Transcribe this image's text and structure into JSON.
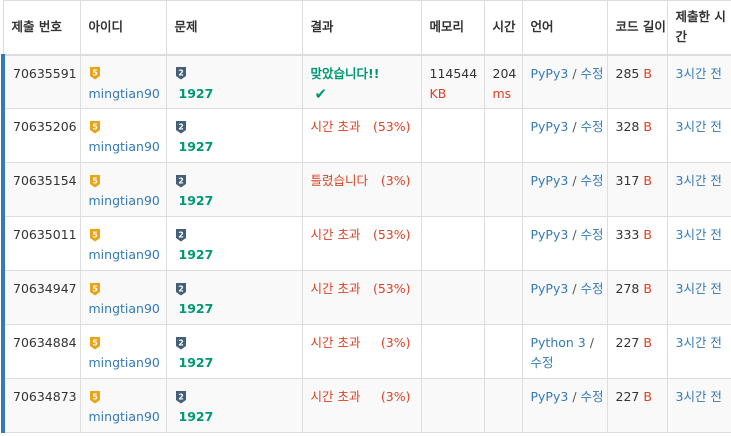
{
  "headers": {
    "submission_id": "제출 번호",
    "user": "아이디",
    "problem": "문제",
    "result": "결과",
    "memory": "메모리",
    "time": "시간",
    "language": "언어",
    "code_length": "코드 길이",
    "submitted": "제출한 시간"
  },
  "colors": {
    "accent": "#337ab7",
    "accepted": "#009874",
    "error": "#dd4124",
    "tier_gold": "#e8a317",
    "problem_badge": "#435f7a"
  },
  "rows": [
    {
      "id": "70635591",
      "user_tier": "5",
      "user": "mingtian90",
      "problem_tier": "2",
      "problem": "1927",
      "result": "맞았습니다!!",
      "result_type": "accepted",
      "result_pct": "",
      "memory": "114544",
      "memory_unit": "KB",
      "time": "204",
      "time_unit": "ms",
      "language": "PyPy3",
      "edit": "수정",
      "length": "285",
      "length_unit": "B",
      "submitted": "3시간 전"
    },
    {
      "id": "70635206",
      "user_tier": "5",
      "user": "mingtian90",
      "problem_tier": "2",
      "problem": "1927",
      "result": "시간 초과",
      "result_type": "tle",
      "result_pct": "(53%)",
      "memory": "",
      "memory_unit": "",
      "time": "",
      "time_unit": "",
      "language": "PyPy3",
      "edit": "수정",
      "length": "328",
      "length_unit": "B",
      "submitted": "3시간 전"
    },
    {
      "id": "70635154",
      "user_tier": "5",
      "user": "mingtian90",
      "problem_tier": "2",
      "problem": "1927",
      "result": "틀렸습니다",
      "result_type": "wrong",
      "result_pct": "(3%)",
      "memory": "",
      "memory_unit": "",
      "time": "",
      "time_unit": "",
      "language": "PyPy3",
      "edit": "수정",
      "length": "317",
      "length_unit": "B",
      "submitted": "3시간 전"
    },
    {
      "id": "70635011",
      "user_tier": "5",
      "user": "mingtian90",
      "problem_tier": "2",
      "problem": "1927",
      "result": "시간 초과",
      "result_type": "tle",
      "result_pct": "(53%)",
      "memory": "",
      "memory_unit": "",
      "time": "",
      "time_unit": "",
      "language": "PyPy3",
      "edit": "수정",
      "length": "333",
      "length_unit": "B",
      "submitted": "3시간 전"
    },
    {
      "id": "70634947",
      "user_tier": "5",
      "user": "mingtian90",
      "problem_tier": "2",
      "problem": "1927",
      "result": "시간 초과",
      "result_type": "tle",
      "result_pct": "(53%)",
      "memory": "",
      "memory_unit": "",
      "time": "",
      "time_unit": "",
      "language": "PyPy3",
      "edit": "수정",
      "length": "278",
      "length_unit": "B",
      "submitted": "3시간 전"
    },
    {
      "id": "70634884",
      "user_tier": "5",
      "user": "mingtian90",
      "problem_tier": "2",
      "problem": "1927",
      "result": "시간 초과",
      "result_type": "tle",
      "result_pct": "(3%)",
      "memory": "",
      "memory_unit": "",
      "time": "",
      "time_unit": "",
      "language": "Python 3",
      "edit": "수정",
      "length": "227",
      "length_unit": "B",
      "submitted": "3시간 전"
    },
    {
      "id": "70634873",
      "user_tier": "5",
      "user": "mingtian90",
      "problem_tier": "2",
      "problem": "1927",
      "result": "시간 초과",
      "result_type": "tle",
      "result_pct": "(3%)",
      "memory": "",
      "memory_unit": "",
      "time": "",
      "time_unit": "",
      "language": "PyPy3",
      "edit": "수정",
      "length": "227",
      "length_unit": "B",
      "submitted": "3시간 전"
    }
  ]
}
